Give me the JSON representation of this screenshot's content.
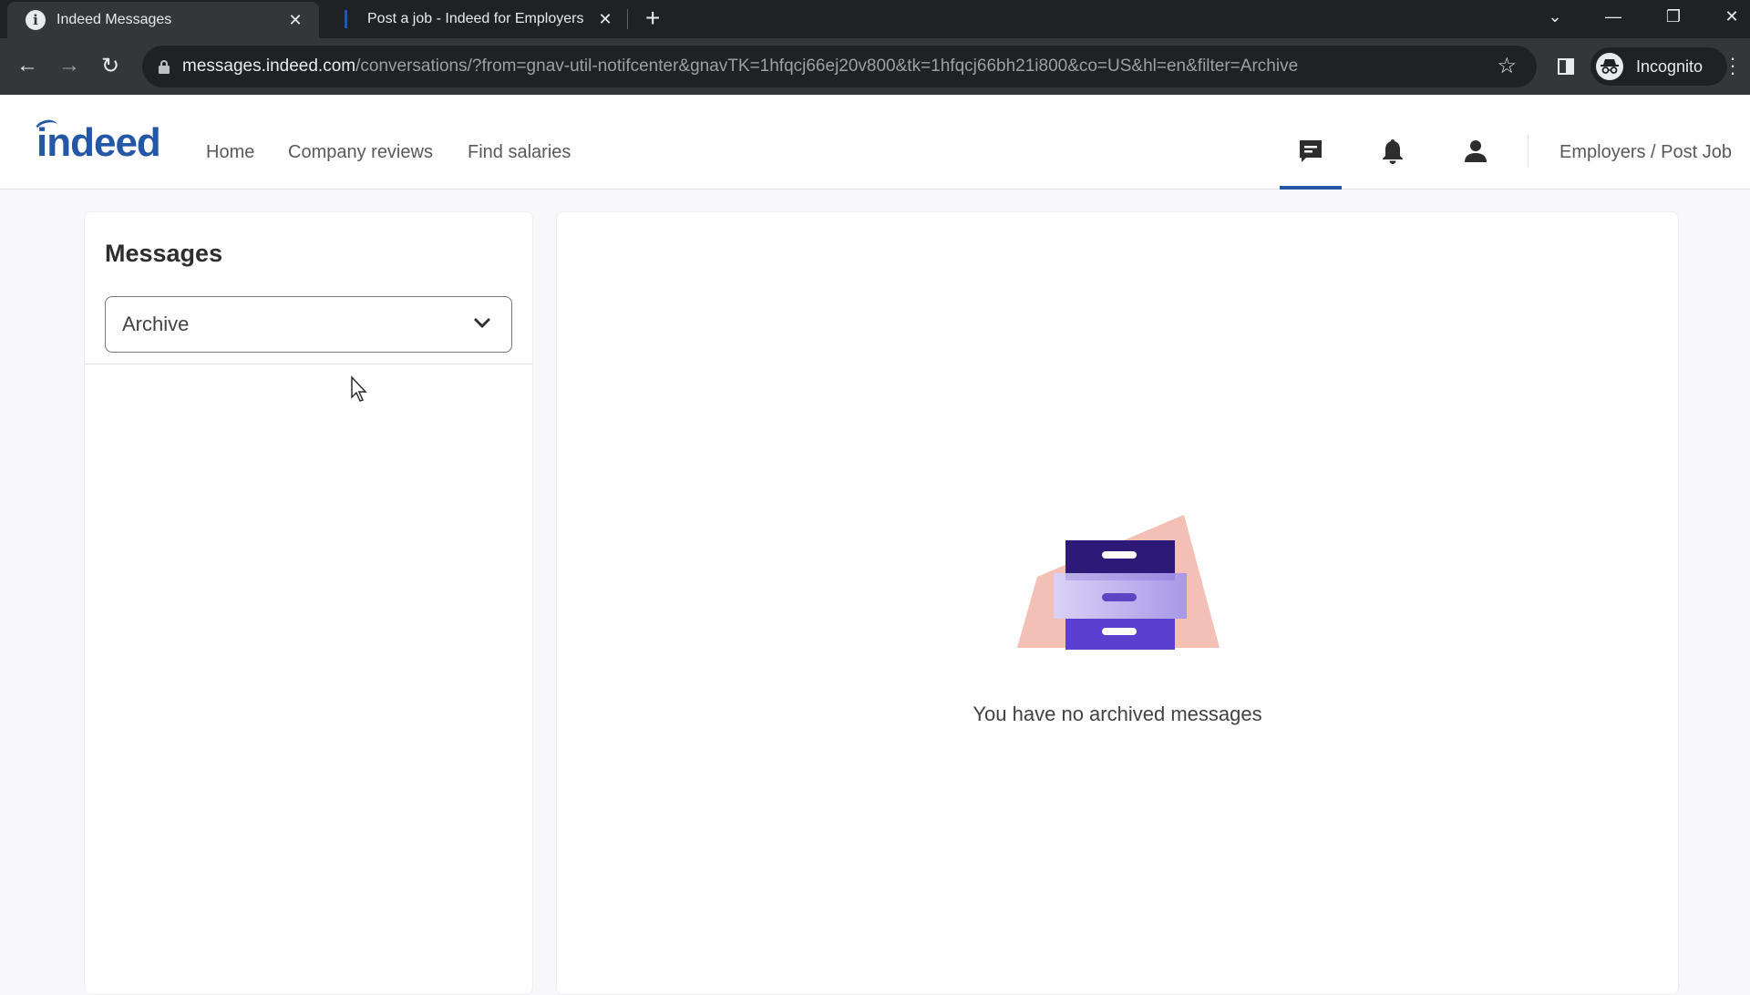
{
  "browser": {
    "tabs": [
      {
        "title": "Indeed Messages",
        "active": true,
        "favicon": "indeed-info-icon"
      },
      {
        "title": "Post a job - Indeed for Employers",
        "active": false,
        "favicon": "indeed-bar-icon"
      }
    ],
    "new_tab_label": "+",
    "close_label": "✕",
    "url_host": "messages.indeed.com",
    "url_path": "/conversations/?from=gnav-util-notifcenter&gnavTK=1hfqcj66ej20v800&tk=1hfqcj66bh21i800&co=US&hl=en&filter=Archive",
    "profile_label": "Incognito",
    "icons": {
      "back": "←",
      "forward": "→",
      "reload": "↻",
      "star": "☆",
      "tab_search": "⌄",
      "minimize": "—",
      "restore": "❐",
      "close": "✕",
      "menu": "⋮"
    }
  },
  "site": {
    "logo_text": "indeed",
    "brand_color": "#2557a7",
    "nav": [
      {
        "label": "Home"
      },
      {
        "label": "Company reviews"
      },
      {
        "label": "Find salaries"
      }
    ],
    "header_icons": [
      "messages-icon",
      "notifications-icon",
      "profile-icon"
    ],
    "employers_link": "Employers / Post Job"
  },
  "messages": {
    "title": "Messages",
    "filter_selected": "Archive",
    "empty_state": "You have no archived messages",
    "illustration": "filing-cabinet"
  }
}
